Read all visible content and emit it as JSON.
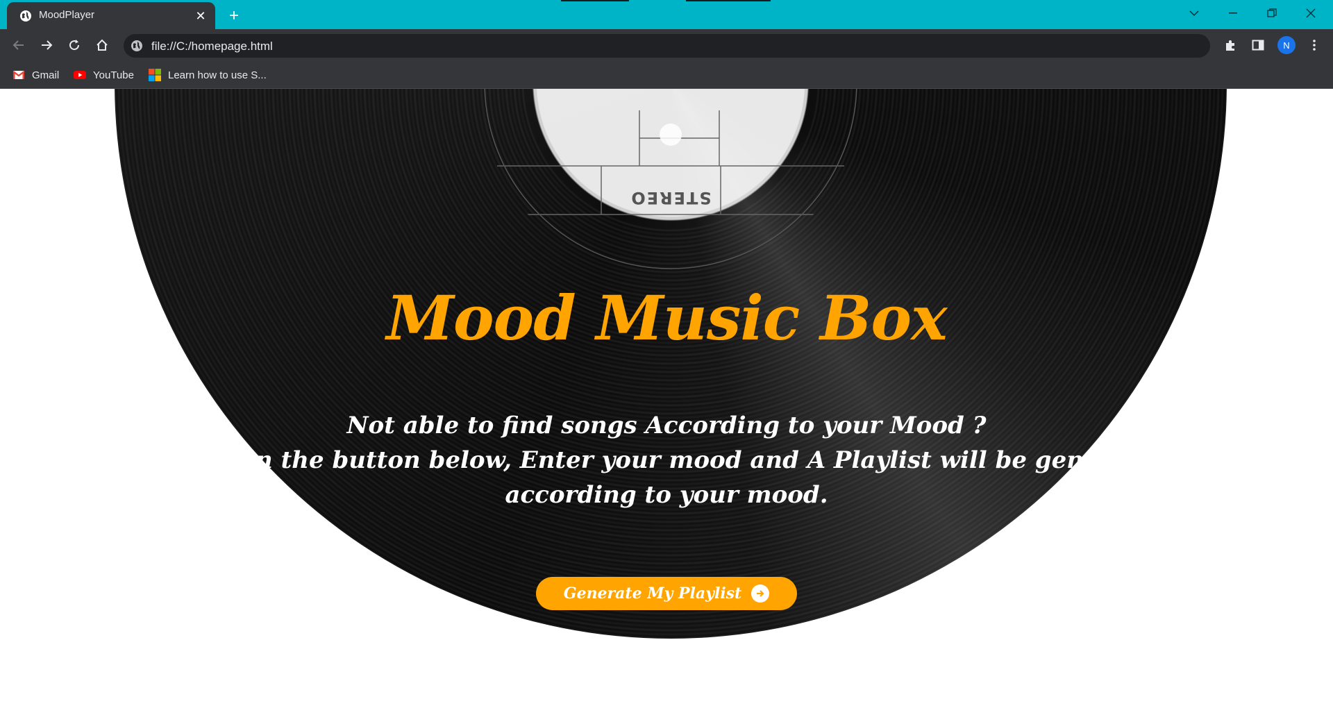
{
  "browser": {
    "tab_title": "MoodPlayer",
    "address": "file://C:/homepage.html",
    "profile_initial": "N",
    "bookmarks": [
      {
        "label": "Gmail",
        "icon": "gmail-icon"
      },
      {
        "label": "YouTube",
        "icon": "youtube-icon"
      },
      {
        "label": "Learn how to use S...",
        "icon": "microsoft-icon"
      }
    ],
    "theme_color": "#00b4c8"
  },
  "page": {
    "title": "Mood Music Box",
    "subtitle_lines": [
      "Not able to find songs According to your Mood ?",
      "Click on the button below, Enter your mood and A Playlist will be generated",
      "according to your mood."
    ],
    "record_label_text": "STEREO",
    "cta_label": "Generate My Playlist",
    "accent_color": "#ffa400"
  }
}
